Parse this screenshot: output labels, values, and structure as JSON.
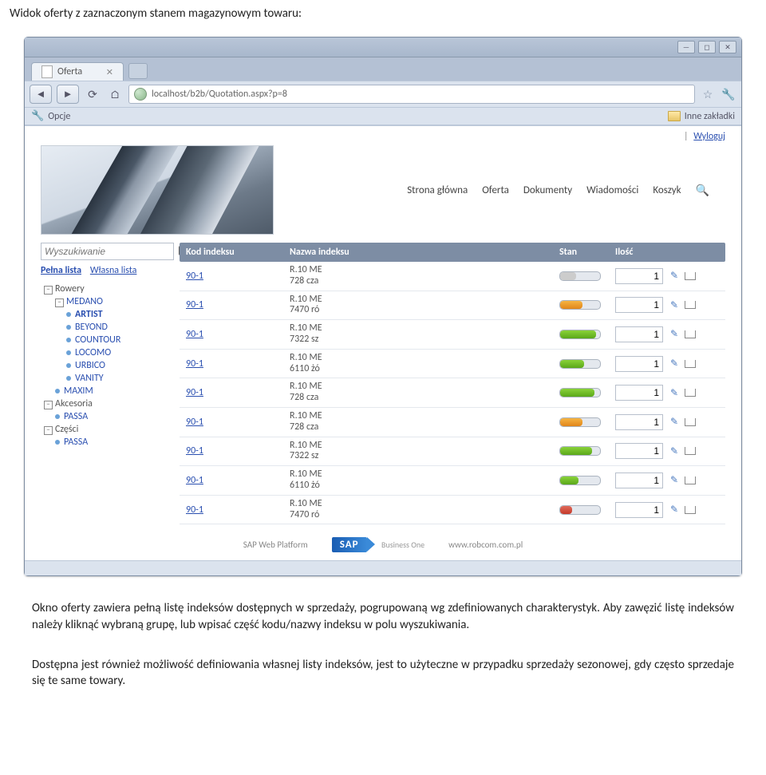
{
  "doc": {
    "title": "Widok oferty z zaznaczonym stanem magazynowym towaru:",
    "para1": "Okno oferty zawiera pełną listę indeksów dostępnych w sprzedaży, pogrupowaną wg zdefiniowanych charakterystyk. Aby zawęzić listę indeksów należy kliknąć wybraną grupę, lub wpisać część kodu/nazwy indeksu w polu wyszukiwania.",
    "para2": "Dostępna jest również możliwość definiowania własnej listy indeksów, jest to użyteczne w przypadku sprzedaży sezonowej, gdy często sprzedaje się te same towary."
  },
  "browser": {
    "tab_title": "Oferta",
    "url": "localhost/b2b/Quotation.aspx?p=8",
    "bookmark_opcje": "Opcje",
    "bookmark_inne": "Inne zakładki"
  },
  "top_links": {
    "logout": "Wyloguj",
    "sep": "|"
  },
  "nav": {
    "home": "Strona główna",
    "offer": "Oferta",
    "docs": "Dokumenty",
    "msgs": "Wiadomości",
    "cart": "Koszyk"
  },
  "sidebar": {
    "search_placeholder": "Wyszukiwanie",
    "full_list": "Pełna lista",
    "own_list": "Własna lista",
    "tree": {
      "rowery": "Rowery",
      "medano": "MEDANO",
      "artist": "ARTIST",
      "beyond": "BEYOND",
      "countour": "COUNTOUR",
      "locomo": "LOCOMO",
      "urbico": "URBICO",
      "vanity": "VANITY",
      "maxim": "MAXIM",
      "akcesoria": "Akcesoria",
      "passa1": "PASSA",
      "czesci": "Części",
      "passa2": "PASSA"
    }
  },
  "grid": {
    "headers": {
      "kod": "Kod indeksu",
      "nazwa": "Nazwa indeksu",
      "stan": "Stan",
      "ilosc": "Ilość"
    },
    "rows": [
      {
        "kod": "90-1",
        "nazwa1": "R.10 ME",
        "nazwa2": "728 cza",
        "stock_color": "grey",
        "stock_pct": 40,
        "qty": "1"
      },
      {
        "kod": "90-1",
        "nazwa1": "R.10 ME",
        "nazwa2": "7470 ró",
        "stock_color": "orange",
        "stock_pct": 55,
        "qty": "1"
      },
      {
        "kod": "90-1",
        "nazwa1": "R.10 ME",
        "nazwa2": "7322 sz",
        "stock_color": "green",
        "stock_pct": 90,
        "qty": "1"
      },
      {
        "kod": "90-1",
        "nazwa1": "R.10 ME",
        "nazwa2": "6110 żó",
        "stock_color": "green",
        "stock_pct": 60,
        "qty": "1"
      },
      {
        "kod": "90-1",
        "nazwa1": "R.10 ME",
        "nazwa2": "728 cza",
        "stock_color": "green",
        "stock_pct": 85,
        "qty": "1"
      },
      {
        "kod": "90-1",
        "nazwa1": "R.10 ME",
        "nazwa2": "728 cza",
        "stock_color": "orange",
        "stock_pct": 55,
        "qty": "1"
      },
      {
        "kod": "90-1",
        "nazwa1": "R.10 ME",
        "nazwa2": "7322 sz",
        "stock_color": "green",
        "stock_pct": 80,
        "qty": "1"
      },
      {
        "kod": "90-1",
        "nazwa1": "R.10 ME",
        "nazwa2": "6110 żó",
        "stock_color": "green",
        "stock_pct": 45,
        "qty": "1"
      },
      {
        "kod": "90-1",
        "nazwa1": "R.10 ME",
        "nazwa2": "7470 ró",
        "stock_color": "red",
        "stock_pct": 30,
        "qty": "1"
      }
    ]
  },
  "footer": {
    "left": "SAP Web Platform",
    "sap": "SAP",
    "sap_sub": "Business One",
    "right": "www.robcom.com.pl"
  }
}
